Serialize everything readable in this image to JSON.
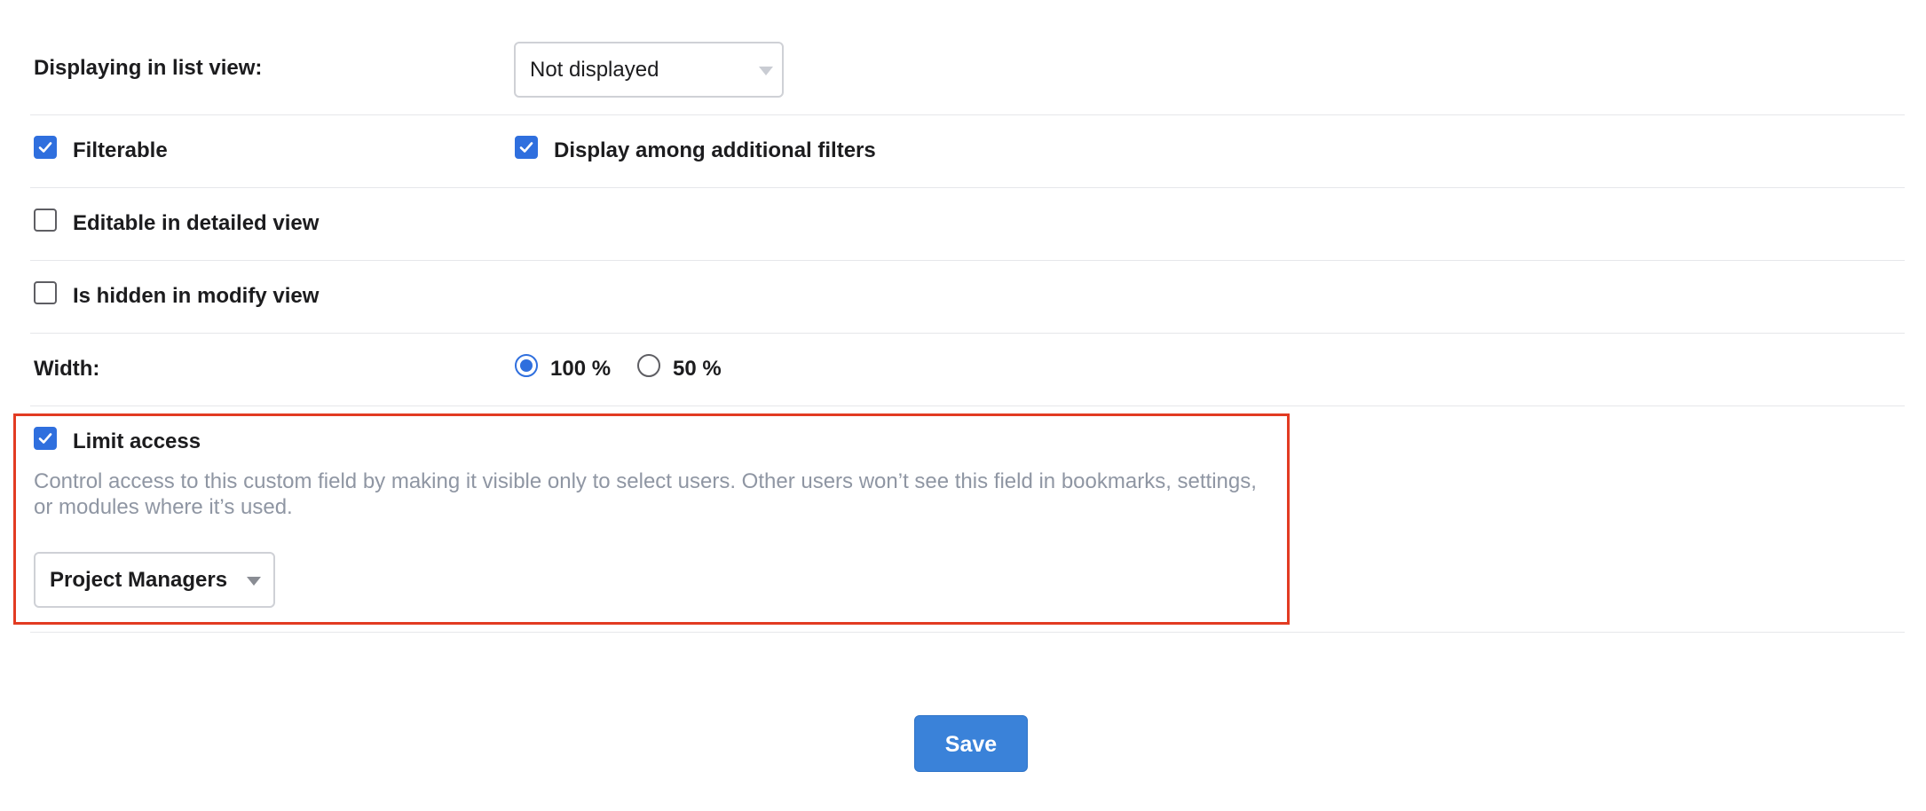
{
  "list_view": {
    "label": "Displaying in list view:",
    "selected": "Not displayed"
  },
  "filterable": {
    "label": "Filterable",
    "checked": true
  },
  "additional_filters": {
    "label": "Display among additional filters",
    "checked": true
  },
  "editable_detailed": {
    "label": "Editable in detailed view",
    "checked": false
  },
  "hidden_modify": {
    "label": "Is hidden in modify view",
    "checked": false
  },
  "width": {
    "label": "Width:",
    "options": [
      {
        "label": "100 %",
        "selected": true
      },
      {
        "label": "50 %",
        "selected": false
      }
    ]
  },
  "limit_access": {
    "label": "Limit access",
    "checked": true,
    "description": "Control access to this custom field by making it visible only to select users. Other users won’t see this field in bookmarks, settings, or modules where it’s used.",
    "group_selected": "Project Managers"
  },
  "actions": {
    "save_label": "Save"
  },
  "colors": {
    "accent": "#2f6fde",
    "save_button": "#3a82d9",
    "highlight_border": "#e23b22",
    "description_text": "#8f96a3"
  }
}
